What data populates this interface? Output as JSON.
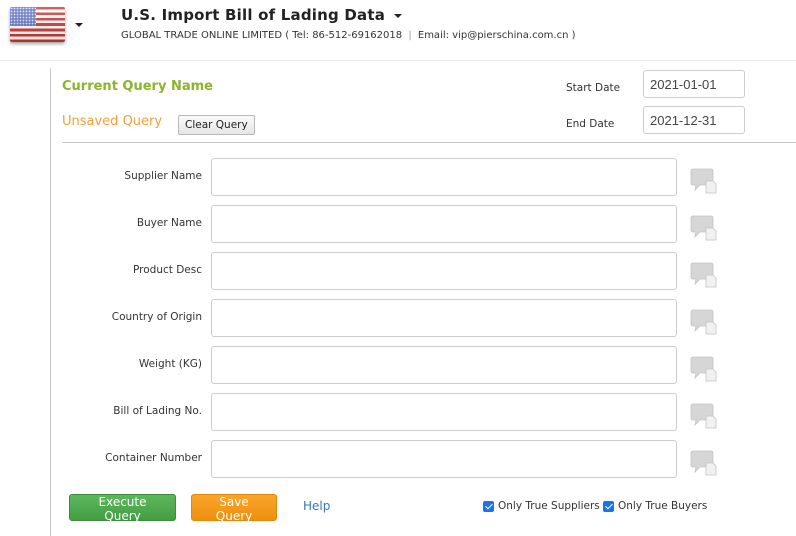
{
  "header": {
    "flag_icon": "us-flag-icon",
    "title": "U.S. Import Bill of Lading Data",
    "company": "GLOBAL TRADE ONLINE LIMITED ( Tel: 86-512-69162018",
    "separator": "|",
    "email": "Email: vip@pierschina.com.cn )"
  },
  "query": {
    "name_label": "Current Query Name",
    "name_value": "Unsaved Query",
    "clear_label": "Clear Query",
    "start_date_label": "Start Date",
    "start_date": "2021-01-01",
    "end_date_label": "End Date",
    "end_date": "2021-12-31"
  },
  "fields": [
    {
      "label": "Supplier Name",
      "value": ""
    },
    {
      "label": "Buyer Name",
      "value": ""
    },
    {
      "label": "Product Desc",
      "value": ""
    },
    {
      "label": "Country of Origin",
      "value": ""
    },
    {
      "label": "Weight (KG)",
      "value": ""
    },
    {
      "label": "Bill of Lading No.",
      "value": ""
    },
    {
      "label": "Container Number",
      "value": ""
    }
  ],
  "actions": {
    "execute_label": "Execute Query",
    "save_label": "Save Query",
    "help_label": "Help",
    "only_true_suppliers_label": "Only True Suppliers",
    "only_true_suppliers_checked": true,
    "only_true_buyers_label": "Only True Buyers",
    "only_true_buyers_checked": true
  },
  "colors": {
    "query_name_label": "#8db32b",
    "unsaved_query": "#f0a03a",
    "execute_button": "#5cb85c",
    "save_button": "#f9a52b",
    "help_link": "#337ab7",
    "checkbox": "#1a73e8"
  }
}
